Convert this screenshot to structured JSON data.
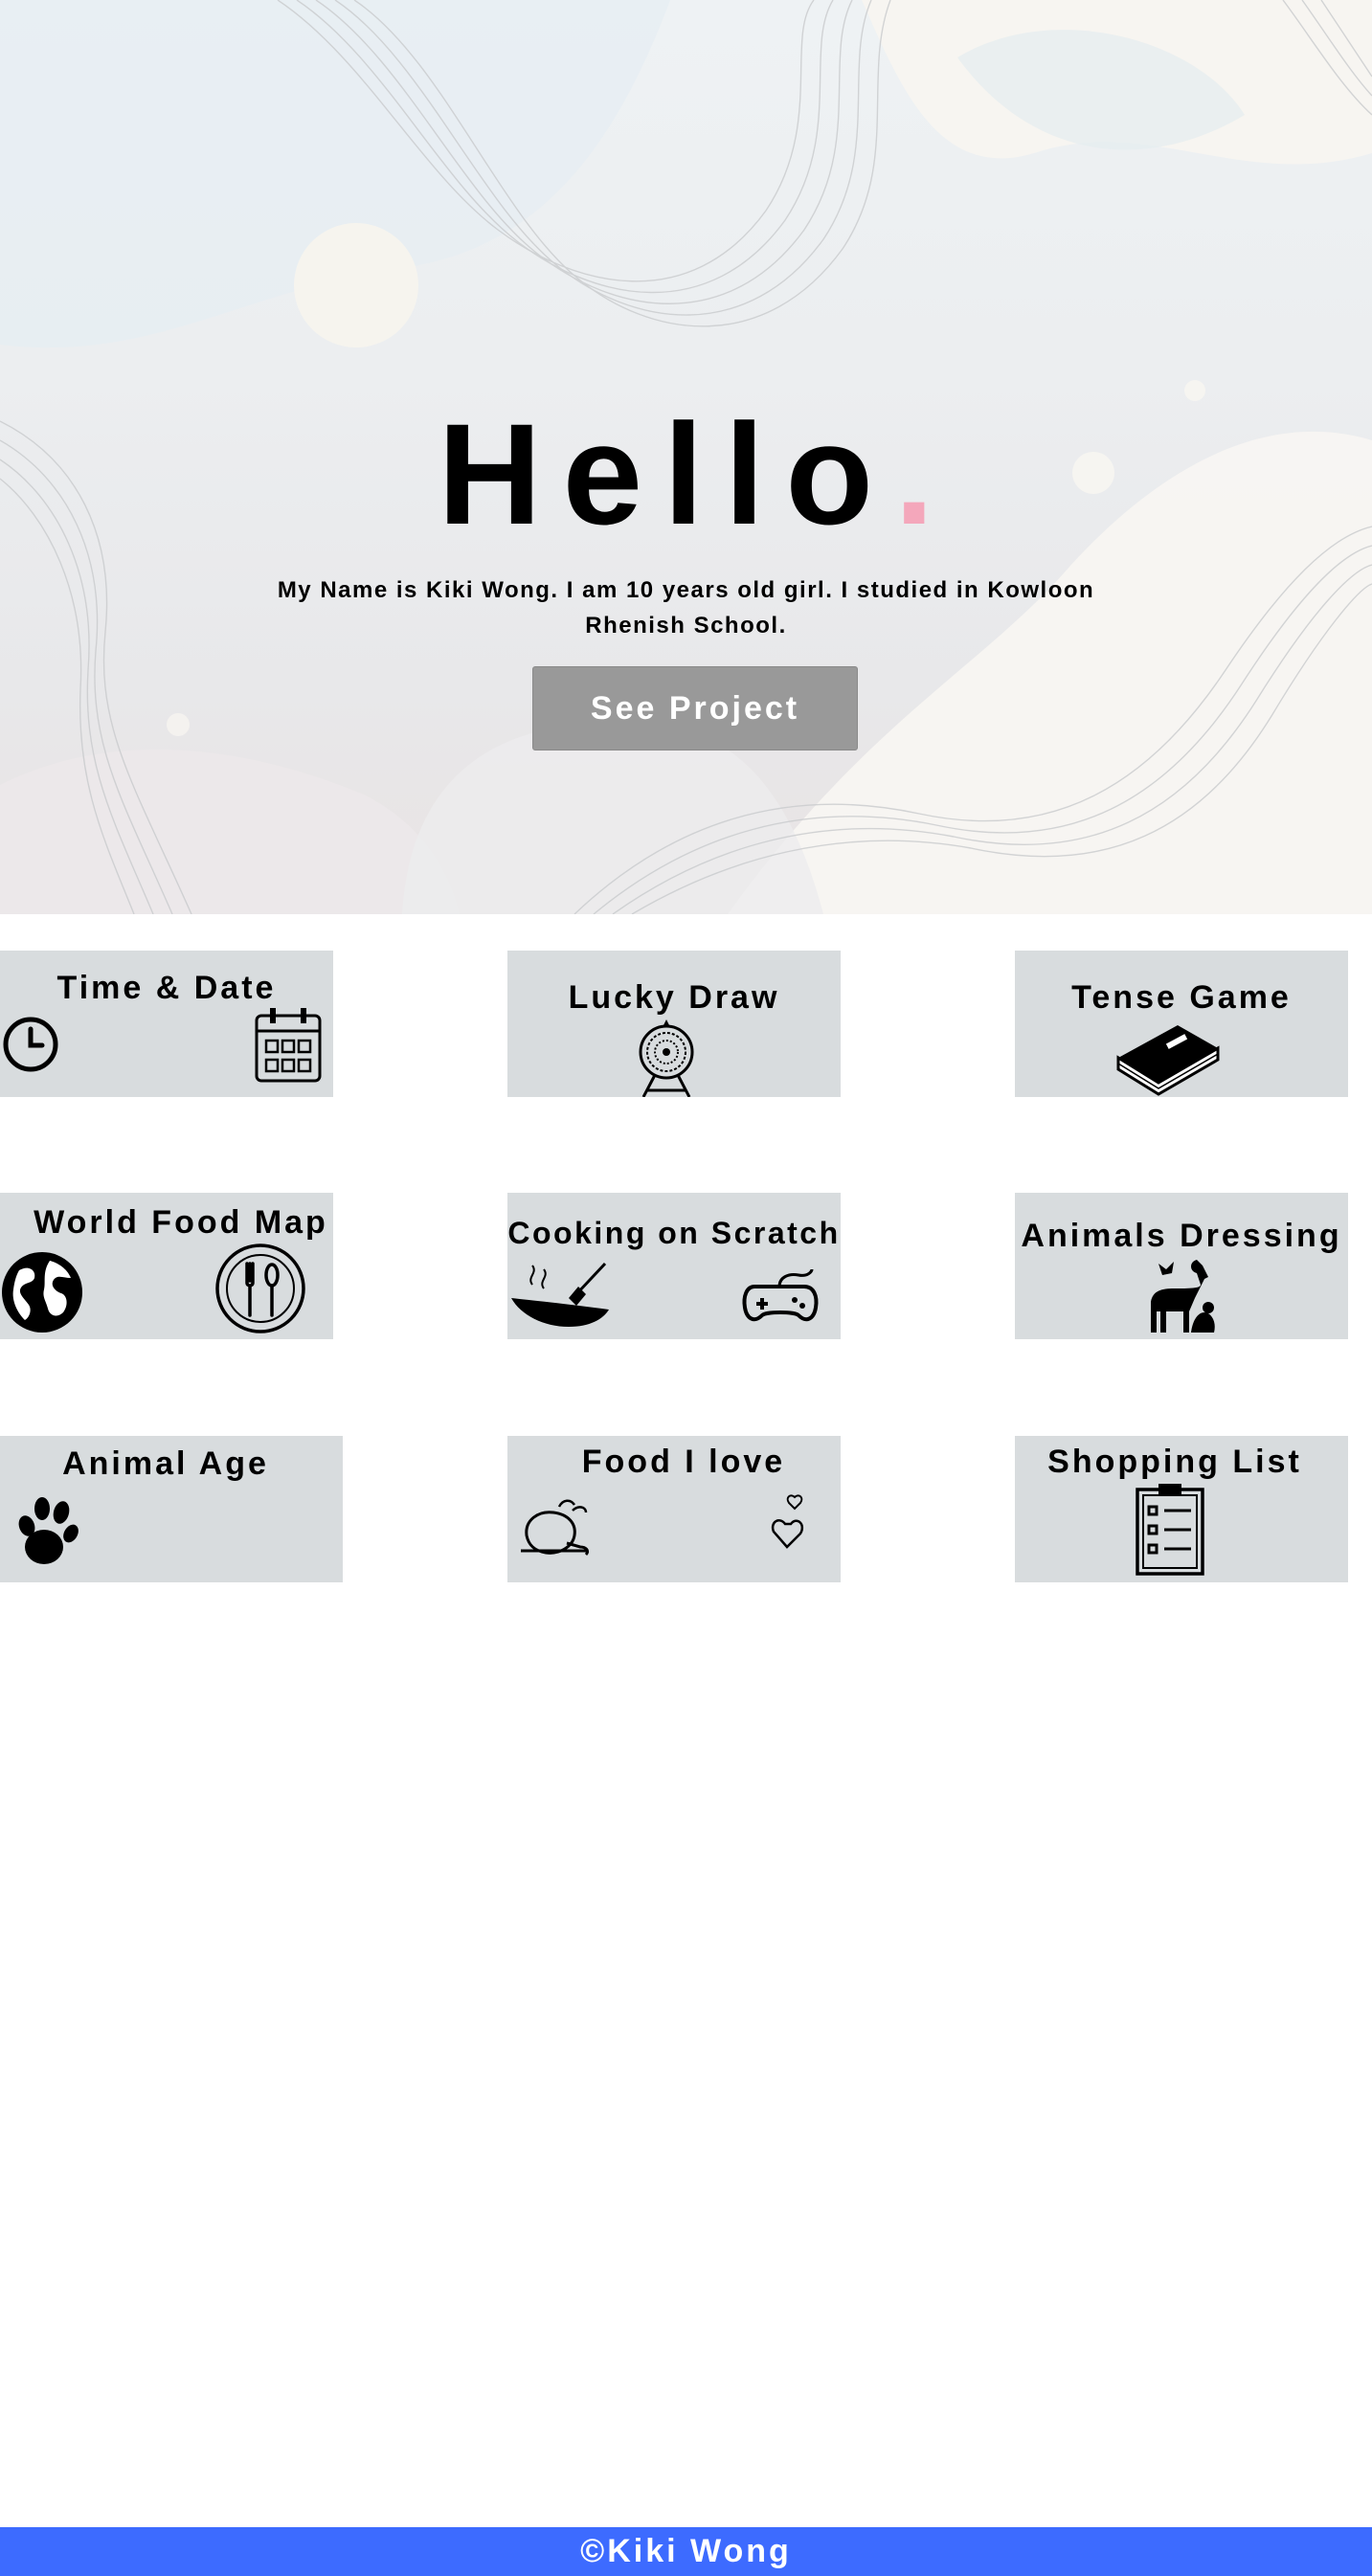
{
  "hero": {
    "greeting": "Hello",
    "greeting_dot": ".",
    "intro": "My Name is Kiki Wong. I am 10 years old girl. I studied in Kowloon Rhenish School.",
    "see_project_label": "See Project"
  },
  "projects": [
    {
      "title": "Time & Date",
      "icons": [
        "clock-icon",
        "calendar-icon"
      ]
    },
    {
      "title": "Lucky Draw",
      "icons": [
        "lottery-wheel-icon"
      ]
    },
    {
      "title": "Tense Game",
      "icons": [
        "book-icon"
      ]
    },
    {
      "title": "World Food Map",
      "icons": [
        "globe-icon",
        "plate-cutlery-icon"
      ]
    },
    {
      "title": "Cooking on Scratch",
      "icons": [
        "wok-icon",
        "gamepad-icon"
      ]
    },
    {
      "title": "Animals Dressing",
      "icons": [
        "animals-icon"
      ]
    },
    {
      "title": "Animal Age",
      "icons": [
        "paw-icon"
      ]
    },
    {
      "title": "Food I love",
      "icons": [
        "roast-chicken-icon",
        "hearts-icon"
      ]
    },
    {
      "title": "Shopping List",
      "icons": [
        "clipboard-list-icon"
      ]
    }
  ],
  "footer": {
    "text": "©Kiki Wong"
  },
  "colors": {
    "footer_bg": "#3d6bff",
    "card_bg": "#d8dcde",
    "button_bg": "#999999",
    "accent_dot": "#f4a7bb"
  }
}
